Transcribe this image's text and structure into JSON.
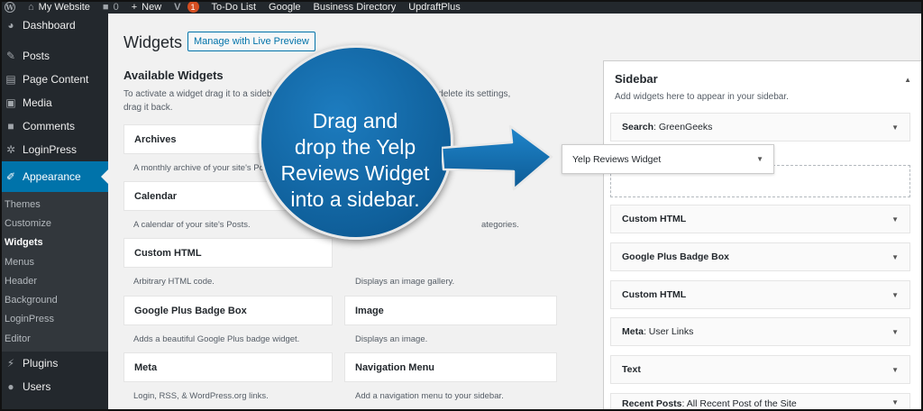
{
  "adminbar": {
    "site_name": "My Website",
    "comments_count": "0",
    "new_label": "New",
    "updates_badge": "1",
    "links": [
      "To-Do List",
      "Google",
      "Business Directory",
      "UpdraftPlus"
    ]
  },
  "menu": {
    "dashboard": "Dashboard",
    "posts": "Posts",
    "page_content": "Page Content",
    "media": "Media",
    "comments": "Comments",
    "loginpress": "LoginPress",
    "appearance": "Appearance",
    "sub": [
      "Themes",
      "Customize",
      "Widgets",
      "Menus",
      "Header",
      "Background",
      "LoginPress",
      "Editor"
    ],
    "plugins": "Plugins",
    "users": "Users"
  },
  "page": {
    "title": "Widgets",
    "live_preview": "Manage with Live Preview",
    "available_title": "Available Widgets",
    "available_desc_a": "To activate a widget drag it to a sidebar or",
    "available_desc_b": "et and delete its settings,",
    "available_desc_c": "drag it back."
  },
  "widgets": {
    "archives": "Archives",
    "archives_desc": "A monthly archive of your site's Po",
    "calendar": "Calendar",
    "calendar_desc": "A calendar of your site's Posts.",
    "categories_desc_tail": "ategories.",
    "custom_html": "Custom HTML",
    "custom_html_desc": "Arbitrary HTML code.",
    "gallery_desc": "Displays an image gallery.",
    "gplus": "Google Plus Badge Box",
    "gplus_desc": "Adds a beautiful Google Plus badge widget.",
    "image": "Image",
    "image_desc": "Displays an image.",
    "meta": "Meta",
    "meta_desc": "Login, RSS, & WordPress.org links.",
    "nav_menu": "Navigation Menu",
    "nav_menu_desc": "Add a navigation menu to your sidebar."
  },
  "sidebar": {
    "title": "Sidebar",
    "desc": "Add widgets here to appear in your sidebar.",
    "items": [
      {
        "name": "Search",
        "sub": ": GreenGeeks"
      },
      {
        "name": "Custom HTML",
        "sub": ""
      },
      {
        "name": "Google Plus Badge Box",
        "sub": ""
      },
      {
        "name": "Custom HTML",
        "sub": ""
      },
      {
        "name": "Meta",
        "sub": ": User Links"
      },
      {
        "name": "Text",
        "sub": ""
      },
      {
        "name": "Recent Posts",
        "sub": ": All Recent Post of the Site"
      }
    ],
    "dragging_widget": "Yelp Reviews Widget"
  },
  "callout": {
    "lines": [
      "Drag and",
      "drop the Yelp",
      "Reviews Widget",
      "into a sidebar."
    ]
  },
  "colors": {
    "admin_dark": "#23282d",
    "accent": "#0073aa",
    "callout": "#0f5f9a"
  }
}
